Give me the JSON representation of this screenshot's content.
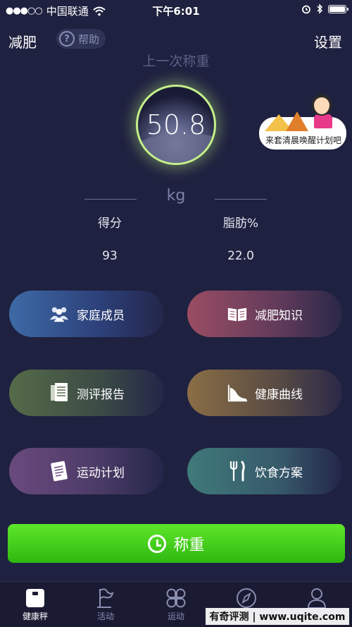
{
  "status_bar": {
    "carrier": "中国联通",
    "time": "下午6:01"
  },
  "header": {
    "title": "减肥",
    "help_label": "帮助",
    "settings_label": "设置"
  },
  "weight": {
    "caption": "上一次称重",
    "value": "50.8",
    "unit": "kg"
  },
  "promo": {
    "text": "来套清晨唤醒计划吧"
  },
  "stats": {
    "score_label": "得分",
    "score_value": "93",
    "fat_label": "脂肪%",
    "fat_value": "22.0"
  },
  "tiles": [
    {
      "label": "家庭成员",
      "icon": "family-icon"
    },
    {
      "label": "减肥知识",
      "icon": "book-icon"
    },
    {
      "label": "测评报告",
      "icon": "report-icon"
    },
    {
      "label": "健康曲线",
      "icon": "curve-icon"
    },
    {
      "label": "运动计划",
      "icon": "plan-icon"
    },
    {
      "label": "饮食方案",
      "icon": "cutlery-icon"
    }
  ],
  "weigh_button": {
    "label": "称重"
  },
  "tabbar": [
    {
      "label": "健康秤",
      "icon": "scale-icon",
      "active": true
    },
    {
      "label": "活动",
      "icon": "flag-icon",
      "active": false
    },
    {
      "label": "运动",
      "icon": "clover-icon",
      "active": false
    },
    {
      "label": "",
      "icon": "compass-icon",
      "active": false
    },
    {
      "label": "",
      "icon": "profile-icon",
      "active": false
    }
  ],
  "watermark": {
    "text": "有奇评测 | www.uqite.com"
  },
  "colors": {
    "background": "#1f2140",
    "accent_green": "#3fcf18",
    "ring_glow": "#c6f08a"
  }
}
